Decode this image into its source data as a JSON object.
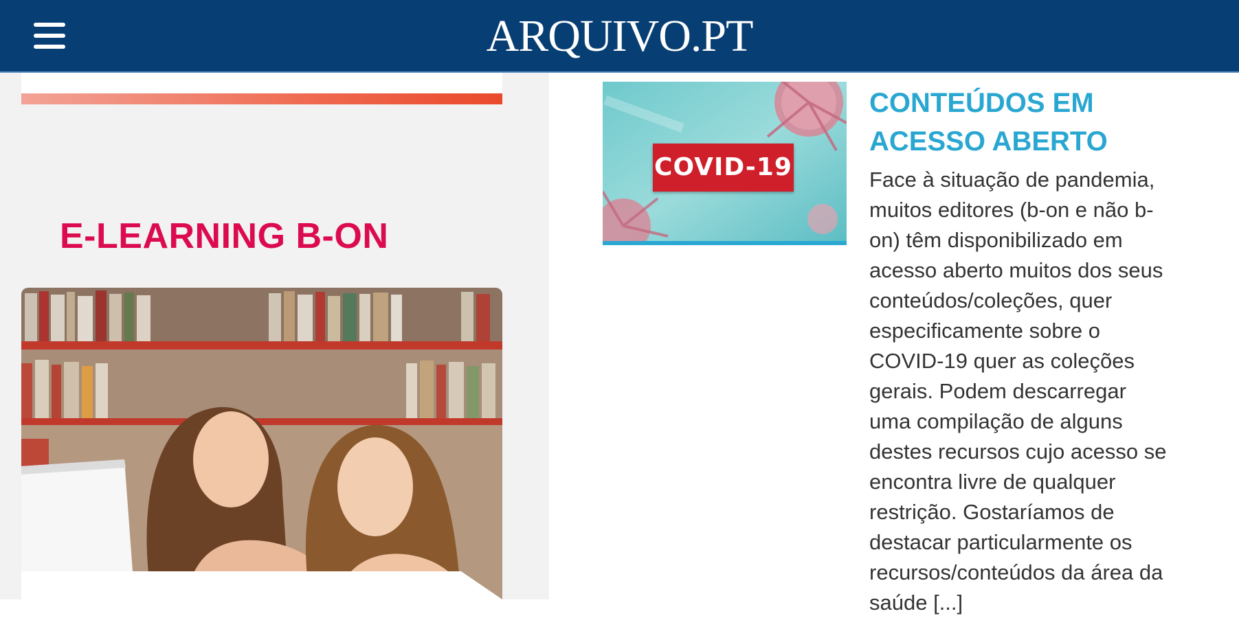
{
  "header": {
    "menu_icon": "hamburger-menu-icon",
    "logo_text": "ARQUIVO.PT",
    "background": "#073e73"
  },
  "left": {
    "section_title": "E-LEARNING B-ON",
    "title_color": "#dc0a4f",
    "image_description": "two-women-at-laptop-library"
  },
  "article": {
    "thumbnail_label": "COVID-19",
    "title": "CONTEÚDOS EM ACESSO ABERTO",
    "title_color": "#2aa7d1",
    "body": "Face à situação de pandemia, muitos editores (b-on e não b-on) têm disponibilizado em acesso aberto muitos dos seus conteúdos/coleções, quer especificamente sobre o COVID-19 quer as coleções gerais. Podem descarregar uma compilação de alguns destes recursos cujo acesso se encontra livre de qualquer restrição. Gostaríamos de destacar particularmente os recursos/conteúdos da área da saúde [...]"
  }
}
